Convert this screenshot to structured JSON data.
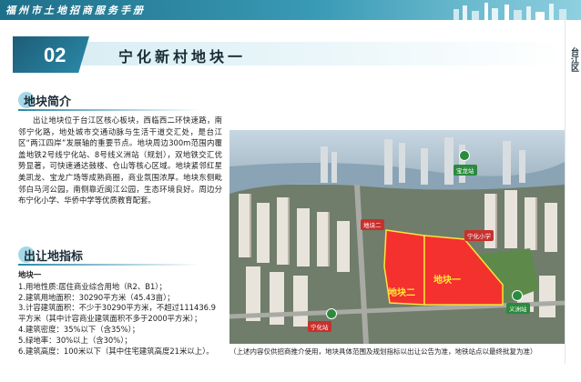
{
  "header": {
    "title": "福州市土地招商服务手册"
  },
  "district": {
    "label": "台江区"
  },
  "section": {
    "number": "02",
    "title": "宁化新村地块一"
  },
  "intro": {
    "heading": "地块简介",
    "text": "出让地块位于台江区核心板块，西临西二环快速路，南邻宁化路，地处城市交通动脉与生活干道交汇处，是台江区“两江四岸”发展轴的重要节点。地块周边300m范围内覆盖地铁2号线宁化站、8号线义洲站（规划），双地铁交汇优势显著，可快速通达鼓楼、仓山等核心区域。地块紧邻红星美凯龙、宝龙广场等成熟商圈，商业氛围浓厚。地块东侧毗邻白马河公园，南侧靠近闽江公园，生态环境良好。周边分布宁化小学、华侨中学等优质教育配套。"
  },
  "indicators": {
    "heading": "出让地指标",
    "plot_name": "地块一",
    "lines": [
      "1.用地性质:居住商业综合用地（R2、B1）；",
      "2.建筑用地面积：30290平方米（45.43亩）；",
      "3.计容建筑面积：不少于30290平方米，不超过111436.9",
      "平方米（其中计容商业建筑面积不多于2000平方米）；",
      "4.建筑密度：35%以下（含35%）；",
      "5.绿地率：30%以上（含30%）；",
      "6.建筑高度：100米以下（其中住宅建筑高度21米以上）。"
    ]
  },
  "photo": {
    "plot_one_label": "地块一",
    "plot_two_label": "地块二",
    "tags": {
      "plot2": "地块二",
      "ninghua_school": "宁化小学",
      "baolong": "宝龙站",
      "ninghua_station": "宁化站",
      "yizhou_station": "义洲站"
    }
  },
  "disclaimer": "（上述内容仅供招商推介使用，地块具体范围及规划指标以出让公告为准，地铁站点以最终批复为准）"
}
